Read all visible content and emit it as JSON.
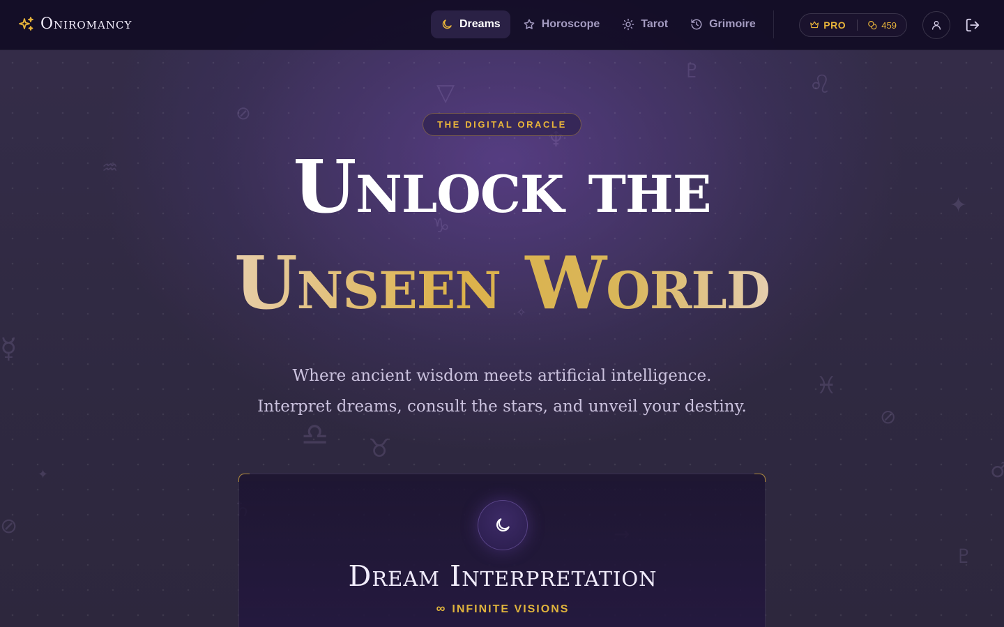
{
  "brand": {
    "name": "Oniromancy"
  },
  "nav": {
    "items": [
      {
        "label": "Dreams",
        "icon": "moon-icon",
        "active": true
      },
      {
        "label": "Horoscope",
        "icon": "star-icon",
        "active": false
      },
      {
        "label": "Tarot",
        "icon": "sun-icon",
        "active": false
      },
      {
        "label": "Grimoire",
        "icon": "history-icon",
        "active": false
      }
    ]
  },
  "account": {
    "plan": "PRO",
    "credits": "459"
  },
  "hero": {
    "badge": "THE DIGITAL ORACLE",
    "title_line1": "Unlock the",
    "title_line2": "Unseen World",
    "subtitle_line1": "Where ancient wisdom meets artificial intelligence.",
    "subtitle_line2": "Interpret dreams, consult the stars, and unveil your destiny."
  },
  "card": {
    "title": "Dream Interpretation",
    "subtitle": "INFINITE VISIONS",
    "subtitle_symbol": "∞"
  },
  "colors": {
    "accent_gold": "#e9b53a",
    "background": "#140e28",
    "purple_glow": "#6034a8"
  }
}
